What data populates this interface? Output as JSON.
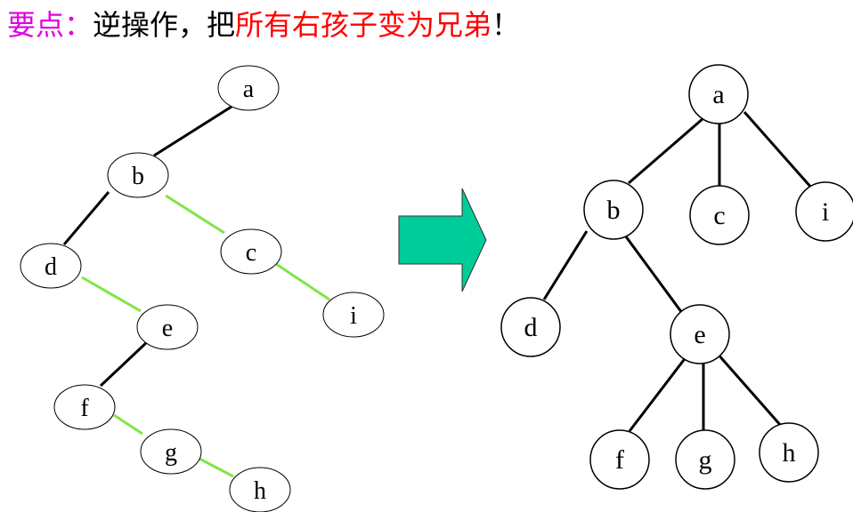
{
  "title": {
    "prefix": "要点：",
    "middle": "逆操作，把",
    "highlight": "所有右孩子变为兄弟",
    "suffix": "！"
  },
  "colors": {
    "prefix": "#e000e0",
    "middle": "#000000",
    "highlight": "#ff0000",
    "edge": "#000000",
    "sibling_edge": "#7fe645",
    "arrow_fill": "#00cc99",
    "arrow_stroke": "#333333",
    "node_fill": "#ffffff",
    "node_stroke": "#000000"
  },
  "binary_tree": {
    "nodes": [
      {
        "id": "a",
        "label": "a"
      },
      {
        "id": "b",
        "label": "b"
      },
      {
        "id": "c",
        "label": "c"
      },
      {
        "id": "d",
        "label": "d"
      },
      {
        "id": "e",
        "label": "e"
      },
      {
        "id": "i",
        "label": "i"
      },
      {
        "id": "f",
        "label": "f"
      },
      {
        "id": "g",
        "label": "g"
      },
      {
        "id": "h",
        "label": "h"
      }
    ],
    "edges": [
      {
        "from": "a",
        "to": "b",
        "kind": "left-child"
      },
      {
        "from": "b",
        "to": "d",
        "kind": "left-child"
      },
      {
        "from": "b",
        "to": "c",
        "kind": "right-sibling"
      },
      {
        "from": "c",
        "to": "i",
        "kind": "right-sibling"
      },
      {
        "from": "d",
        "to": "e",
        "kind": "right-sibling"
      },
      {
        "from": "e",
        "to": "f",
        "kind": "left-child"
      },
      {
        "from": "f",
        "to": "g",
        "kind": "right-sibling"
      },
      {
        "from": "g",
        "to": "h",
        "kind": "right-sibling"
      }
    ]
  },
  "general_tree": {
    "nodes": [
      {
        "id": "a",
        "label": "a"
      },
      {
        "id": "b",
        "label": "b"
      },
      {
        "id": "c",
        "label": "c"
      },
      {
        "id": "i",
        "label": "i"
      },
      {
        "id": "d",
        "label": "d"
      },
      {
        "id": "e",
        "label": "e"
      },
      {
        "id": "f",
        "label": "f"
      },
      {
        "id": "g",
        "label": "g"
      },
      {
        "id": "h",
        "label": "h"
      }
    ],
    "edges": [
      {
        "from": "a",
        "to": "b"
      },
      {
        "from": "a",
        "to": "c"
      },
      {
        "from": "a",
        "to": "i"
      },
      {
        "from": "b",
        "to": "d"
      },
      {
        "from": "b",
        "to": "e"
      },
      {
        "from": "e",
        "to": "f"
      },
      {
        "from": "e",
        "to": "g"
      },
      {
        "from": "e",
        "to": "h"
      }
    ]
  }
}
